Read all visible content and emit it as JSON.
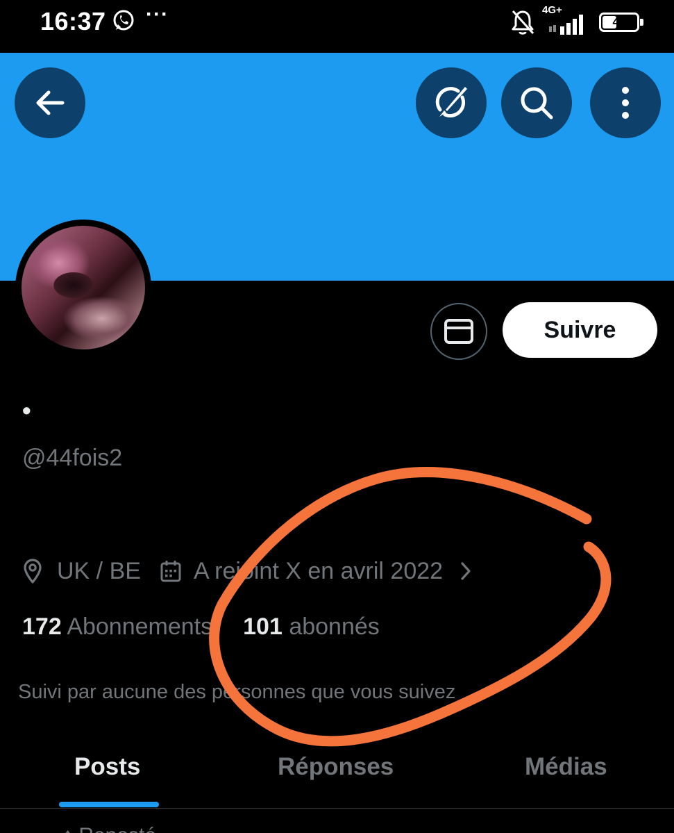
{
  "status_bar": {
    "time": "16:37",
    "more": "···",
    "network": "4G+",
    "battery_level": "41",
    "battery_fraction": 0.41
  },
  "colors": {
    "banner": "#1d9bf0",
    "accent": "#1d9bf0",
    "annotation": "#f4743b",
    "background": "#000000",
    "secondary_text": "#71767b"
  },
  "icons": [
    "whatsapp-icon",
    "mute-bell-icon",
    "signal-icon",
    "battery-icon",
    "back-arrow-icon",
    "grok-icon",
    "search-icon",
    "more-vertical-icon",
    "mail-icon",
    "location-icon",
    "calendar-icon",
    "chevron-right-icon"
  ],
  "profile": {
    "display_name": "•",
    "handle": "@44fois2",
    "location": "UK / BE",
    "joined": "A rejoint X en avril 2022",
    "following_count": "172",
    "following_label": "Abonnements",
    "followers_count": "101",
    "followers_label": "abonnés",
    "followed_by": "Suivi par aucune des personnes que vous suivez"
  },
  "actions": {
    "follow_label": "Suivre"
  },
  "tabs": [
    {
      "label": "Posts",
      "active": true
    },
    {
      "label": "Réponses",
      "active": false
    },
    {
      "label": "Médias",
      "active": false
    }
  ],
  "partial_text": "↑ Reposté"
}
